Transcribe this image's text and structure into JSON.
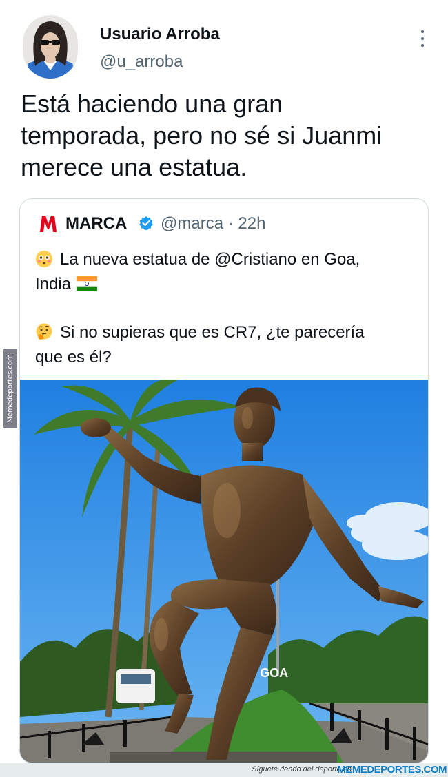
{
  "tweet": {
    "display_name": "Usuario Arroba",
    "handle": "@u_arroba",
    "text_lines": [
      "Está haciendo una gran",
      "temporada, pero no sé si Juanmi",
      "merece una estatua."
    ]
  },
  "quoted": {
    "logo_letter": "M",
    "name": "MARCA",
    "handle_time": "@marca · 22h",
    "line1": "La nueva estatua de @Cristiano en Goa,",
    "line2": "India",
    "line3": "Si no supieras que es CR7, ¿te parecería",
    "line4": "que es él?",
    "sign_text": "I ❤ GOA"
  },
  "icons": {
    "more": "more-vertical-icon",
    "verified": "verified-badge-icon",
    "emoji1": "flushed-face-emoji",
    "emoji2": "thinking-face-emoji",
    "flag": "india-flag-icon"
  },
  "watermark": {
    "side": "Memedeportes.com",
    "footer_text": "Síguete riendo del deporte en",
    "footer_brand": "MEMEDEPORTES.COM"
  },
  "colors": {
    "verified": "#1d9bf0",
    "marca_red": "#e2001a",
    "brand_blue": "#0d7ec4"
  }
}
